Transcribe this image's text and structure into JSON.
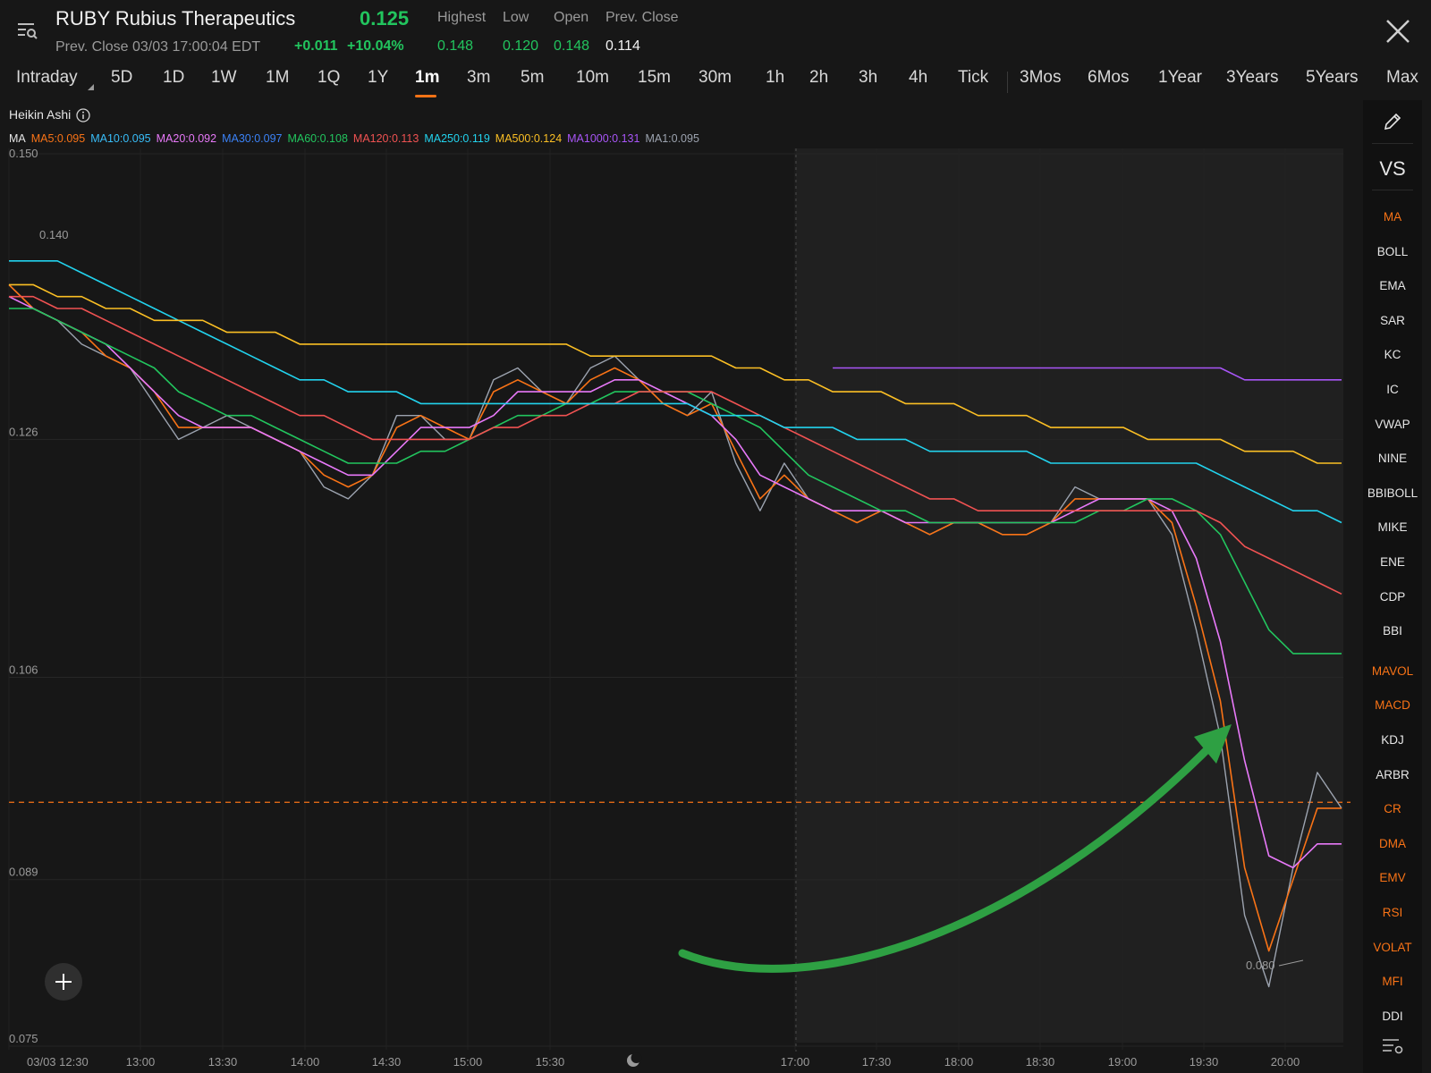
{
  "header": {
    "symbol_title": "RUBY Rubius Therapeutics",
    "price": "0.125",
    "prev_close_line": "Prev. Close 03/03 17:00:04 EDT",
    "change": "+0.011",
    "change_pct": "+10.04%",
    "stats": [
      {
        "label": "Highest",
        "value": "0.148"
      },
      {
        "label": "Low",
        "value": "0.120"
      },
      {
        "label": "Open",
        "value": "0.148"
      },
      {
        "label": "Prev. Close",
        "value": "0.114"
      }
    ]
  },
  "tabs": [
    "Intraday",
    "5D",
    "1D",
    "1W",
    "1M",
    "1Q",
    "1Y",
    "1m",
    "3m",
    "5m",
    "10m",
    "15m",
    "30m",
    "1h",
    "2h",
    "3h",
    "4h",
    "Tick",
    "3Mos",
    "6Mos",
    "1Year",
    "3Years",
    "5Years",
    "Max"
  ],
  "active_tab": "1m",
  "chart_type_label": "Heikin Ashi",
  "ma": {
    "label": "MA",
    "items": [
      {
        "text": "MA5:0.095",
        "color": "#f97316"
      },
      {
        "text": "MA10:0.095",
        "color": "#38bdf8"
      },
      {
        "text": "MA20:0.092",
        "color": "#e879f9"
      },
      {
        "text": "MA30:0.097",
        "color": "#3b82f6"
      },
      {
        "text": "MA60:0.108",
        "color": "#22c55e"
      },
      {
        "text": "MA120:0.113",
        "color": "#f05252"
      },
      {
        "text": "MA250:0.119",
        "color": "#22d3ee"
      },
      {
        "text": "MA500:0.124",
        "color": "#fbbf24"
      },
      {
        "text": "MA1000:0.131",
        "color": "#a855f7"
      },
      {
        "text": "MA1:0.095",
        "color": "#9ca3af"
      }
    ]
  },
  "chart_data": {
    "type": "line",
    "y_ticks": [
      "0.150",
      "0.126",
      "0.106",
      "0.089",
      "0.075"
    ],
    "x_ticks": [
      "03/03 12:30",
      "13:00",
      "13:30",
      "14:00",
      "14:30",
      "15:00",
      "15:30",
      "17:00",
      "17:30",
      "18:00",
      "18:30",
      "19:00",
      "19:30",
      "20:00"
    ],
    "ylim": [
      0.075,
      0.15
    ],
    "high_label": "0.140",
    "low_label": "0.080",
    "reference_line": 0.0955,
    "series": [
      {
        "key": "price",
        "color": "#9ca3af",
        "values": [
          0.139,
          0.137,
          0.136,
          0.134,
          0.133,
          0.132,
          0.129,
          0.126,
          0.127,
          0.128,
          0.127,
          0.126,
          0.125,
          0.122,
          0.121,
          0.123,
          0.128,
          0.128,
          0.126,
          0.126,
          0.131,
          0.132,
          0.13,
          0.129,
          0.132,
          0.133,
          0.131,
          0.129,
          0.128,
          0.13,
          0.124,
          0.12,
          0.124,
          0.121,
          0.12,
          0.119,
          0.12,
          0.119,
          0.118,
          0.119,
          0.119,
          0.118,
          0.118,
          0.119,
          0.122,
          0.121,
          0.121,
          0.121,
          0.118,
          0.11,
          0.101,
          0.086,
          0.08,
          0.09,
          0.098,
          0.095
        ]
      },
      {
        "key": "ma5",
        "color": "#f97316",
        "values": [
          0.139,
          0.137,
          0.136,
          0.135,
          0.133,
          0.132,
          0.13,
          0.127,
          0.127,
          0.127,
          0.127,
          0.126,
          0.125,
          0.123,
          0.122,
          0.123,
          0.127,
          0.128,
          0.127,
          0.126,
          0.13,
          0.131,
          0.13,
          0.129,
          0.131,
          0.132,
          0.131,
          0.129,
          0.128,
          0.129,
          0.125,
          0.121,
          0.123,
          0.121,
          0.12,
          0.119,
          0.12,
          0.119,
          0.118,
          0.119,
          0.119,
          0.118,
          0.118,
          0.119,
          0.121,
          0.121,
          0.121,
          0.121,
          0.119,
          0.112,
          0.104,
          0.09,
          0.083,
          0.089,
          0.095,
          0.095
        ]
      },
      {
        "key": "ma20",
        "color": "#e879f9",
        "values": [
          0.138,
          0.137,
          0.136,
          0.135,
          0.134,
          0.132,
          0.13,
          0.128,
          0.127,
          0.127,
          0.127,
          0.126,
          0.125,
          0.124,
          0.123,
          0.123,
          0.125,
          0.127,
          0.127,
          0.127,
          0.128,
          0.13,
          0.13,
          0.13,
          0.13,
          0.131,
          0.131,
          0.13,
          0.129,
          0.128,
          0.126,
          0.123,
          0.122,
          0.121,
          0.12,
          0.12,
          0.12,
          0.119,
          0.119,
          0.119,
          0.119,
          0.119,
          0.119,
          0.119,
          0.12,
          0.121,
          0.121,
          0.121,
          0.12,
          0.116,
          0.109,
          0.099,
          0.091,
          0.09,
          0.092,
          0.092
        ]
      },
      {
        "key": "ma60",
        "color": "#22c55e",
        "values": [
          0.137,
          0.137,
          0.136,
          0.135,
          0.134,
          0.133,
          0.132,
          0.13,
          0.129,
          0.128,
          0.128,
          0.127,
          0.126,
          0.125,
          0.124,
          0.124,
          0.124,
          0.125,
          0.125,
          0.126,
          0.127,
          0.128,
          0.128,
          0.129,
          0.129,
          0.13,
          0.13,
          0.13,
          0.13,
          0.129,
          0.128,
          0.127,
          0.125,
          0.123,
          0.122,
          0.121,
          0.12,
          0.12,
          0.119,
          0.119,
          0.119,
          0.119,
          0.119,
          0.119,
          0.119,
          0.12,
          0.12,
          0.121,
          0.121,
          0.12,
          0.118,
          0.114,
          0.11,
          0.108,
          0.108,
          0.108
        ]
      },
      {
        "key": "ma120",
        "color": "#f05252",
        "values": [
          0.138,
          0.138,
          0.137,
          0.137,
          0.136,
          0.135,
          0.134,
          0.133,
          0.132,
          0.131,
          0.13,
          0.129,
          0.128,
          0.128,
          0.127,
          0.126,
          0.126,
          0.126,
          0.126,
          0.126,
          0.127,
          0.127,
          0.128,
          0.128,
          0.129,
          0.129,
          0.13,
          0.13,
          0.13,
          0.13,
          0.129,
          0.128,
          0.127,
          0.126,
          0.125,
          0.124,
          0.123,
          0.122,
          0.121,
          0.121,
          0.12,
          0.12,
          0.12,
          0.12,
          0.12,
          0.12,
          0.12,
          0.12,
          0.12,
          0.12,
          0.119,
          0.117,
          0.116,
          0.115,
          0.114,
          0.113
        ]
      },
      {
        "key": "ma250",
        "color": "#22d3ee",
        "values": [
          0.141,
          0.141,
          0.141,
          0.14,
          0.139,
          0.138,
          0.137,
          0.136,
          0.135,
          0.134,
          0.133,
          0.132,
          0.131,
          0.131,
          0.13,
          0.13,
          0.13,
          0.129,
          0.129,
          0.129,
          0.129,
          0.129,
          0.129,
          0.129,
          0.129,
          0.129,
          0.129,
          0.129,
          0.129,
          0.128,
          0.128,
          0.128,
          0.127,
          0.127,
          0.127,
          0.126,
          0.126,
          0.126,
          0.125,
          0.125,
          0.125,
          0.125,
          0.125,
          0.124,
          0.124,
          0.124,
          0.124,
          0.124,
          0.124,
          0.124,
          0.123,
          0.122,
          0.121,
          0.12,
          0.12,
          0.119
        ]
      },
      {
        "key": "ma500",
        "color": "#fbbf24",
        "values": [
          0.139,
          0.139,
          0.138,
          0.138,
          0.137,
          0.137,
          0.136,
          0.136,
          0.136,
          0.135,
          0.135,
          0.135,
          0.134,
          0.134,
          0.134,
          0.134,
          0.134,
          0.134,
          0.134,
          0.134,
          0.134,
          0.134,
          0.134,
          0.134,
          0.133,
          0.133,
          0.133,
          0.133,
          0.133,
          0.133,
          0.132,
          0.132,
          0.131,
          0.131,
          0.13,
          0.13,
          0.13,
          0.129,
          0.129,
          0.129,
          0.128,
          0.128,
          0.128,
          0.127,
          0.127,
          0.127,
          0.127,
          0.126,
          0.126,
          0.126,
          0.126,
          0.125,
          0.125,
          0.125,
          0.124,
          0.124
        ]
      },
      {
        "key": "ma1000",
        "color": "#a855f7",
        "start_index": 34,
        "values": [
          0.132,
          0.132,
          0.132,
          0.132,
          0.132,
          0.132,
          0.132,
          0.132,
          0.132,
          0.132,
          0.132,
          0.132,
          0.132,
          0.132,
          0.132,
          0.132,
          0.132,
          0.131,
          0.131,
          0.131,
          0.131,
          0.131
        ]
      }
    ]
  },
  "right_panel": {
    "vs": "VS",
    "items": [
      {
        "label": "MA",
        "orange": true
      },
      {
        "label": "BOLL",
        "orange": false
      },
      {
        "label": "EMA",
        "orange": false
      },
      {
        "label": "SAR",
        "orange": false
      },
      {
        "label": "KC",
        "orange": false
      },
      {
        "label": "IC",
        "orange": false
      },
      {
        "label": "VWAP",
        "orange": false
      },
      {
        "label": "NINE",
        "orange": false
      },
      {
        "label": "BBIBOLL",
        "orange": false
      },
      {
        "label": "MIKE",
        "orange": false
      },
      {
        "label": "ENE",
        "orange": false
      },
      {
        "label": "CDP",
        "orange": false
      },
      {
        "label": "BBI",
        "orange": false
      },
      {
        "label": "MAVOL",
        "orange": true
      },
      {
        "label": "MACD",
        "orange": true
      },
      {
        "label": "KDJ",
        "orange": false
      },
      {
        "label": "ARBR",
        "orange": false
      },
      {
        "label": "CR",
        "orange": true
      },
      {
        "label": "DMA",
        "orange": true
      },
      {
        "label": "EMV",
        "orange": true
      },
      {
        "label": "RSI",
        "orange": true
      },
      {
        "label": "VOLAT",
        "orange": true
      },
      {
        "label": "MFI",
        "orange": true
      },
      {
        "label": "DDI",
        "orange": false
      }
    ]
  },
  "annotation_color": "#2ea043"
}
